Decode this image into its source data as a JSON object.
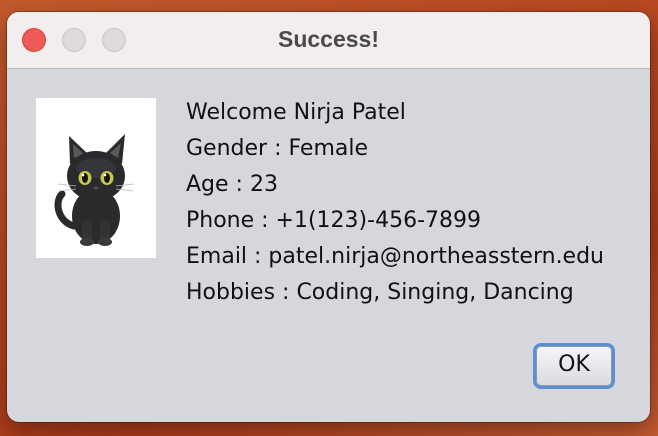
{
  "window": {
    "title": "Success!"
  },
  "avatar": {
    "icon": "black-cat-icon",
    "colors": {
      "fur": "#2a2a2c",
      "eyes": "#c6c64a"
    }
  },
  "info": {
    "welcome": "Welcome Nirja Patel",
    "gender": "Gender : Female",
    "age": "Age : 23",
    "phone": "Phone : +1(123)-456-7899",
    "email": "Email : patel.nirja@northeasstern.edu",
    "hobbies": "Hobbies : Coding, Singing, Dancing"
  },
  "buttons": {
    "ok_label": "OK"
  }
}
